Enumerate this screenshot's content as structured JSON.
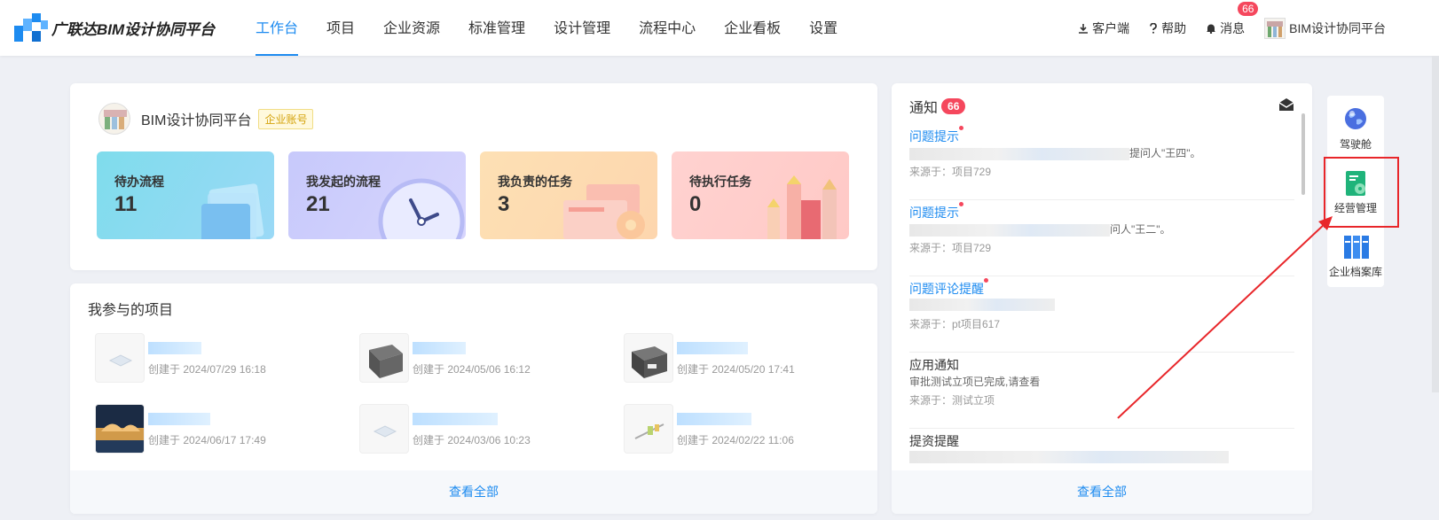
{
  "app": {
    "name": "广联达BIM设计协同平台"
  },
  "nav": {
    "items": [
      "工作台",
      "项目",
      "企业资源",
      "标准管理",
      "设计管理",
      "流程中心",
      "企业看板",
      "设置"
    ],
    "active_index": 0
  },
  "topbar": {
    "client": "客户端",
    "help": "帮助",
    "messages": "消息",
    "message_count": "66",
    "org": "BIM设计协同平台"
  },
  "org": {
    "name": "BIM设计协同平台",
    "tag": "企业账号"
  },
  "stats": [
    {
      "label": "待办流程",
      "value": "11"
    },
    {
      "label": "我发起的流程",
      "value": "21"
    },
    {
      "label": "我负责的任务",
      "value": "3"
    },
    {
      "label": "待执行任务",
      "value": "0"
    }
  ],
  "projects": {
    "title": "我参与的项目",
    "items": [
      {
        "date": "创建于 2024/07/29 16:18"
      },
      {
        "date": "创建于 2024/05/06 16:12"
      },
      {
        "date": "创建于 2024/05/20 17:41"
      },
      {
        "date": "创建于 2024/06/17 17:49"
      },
      {
        "date": "创建于 2024/03/06 10:23"
      },
      {
        "date": "创建于 2024/02/22 11:06"
      }
    ],
    "view_all": "查看全部"
  },
  "notices": {
    "title": "通知",
    "count": "66",
    "items": [
      {
        "title": "问题提示",
        "line_tail": "提问人\"王四\"。",
        "source": "来源于：项目729",
        "unread": true
      },
      {
        "title": "问题提示",
        "line_tail": "问人\"王二\"。",
        "source": "来源于：项目729",
        "unread": true
      },
      {
        "title": "问题评论提醒",
        "line_tail": "",
        "source": "来源于：pt项目617",
        "unread": true
      },
      {
        "title": "应用通知",
        "line_tail": "审批测试立项已完成,请查看",
        "source": "来源于：测试立项",
        "unread": false
      },
      {
        "title": "提资提醒",
        "line_tail": "",
        "source": "",
        "unread": false
      }
    ],
    "view_all": "查看全部"
  },
  "rail": [
    {
      "label": "驾驶舱",
      "icon": "globe-icon"
    },
    {
      "label": "经营管理",
      "icon": "document-icon"
    },
    {
      "label": "企业档案库",
      "icon": "binders-icon"
    }
  ],
  "colors": {
    "brand": "#1d8bf0",
    "badge": "#f5475d",
    "highlight": "#e8262a"
  }
}
